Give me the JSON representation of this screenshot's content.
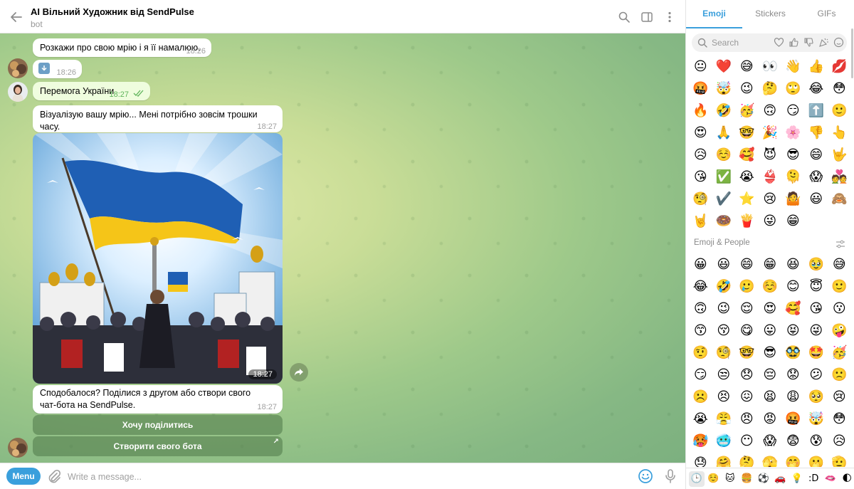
{
  "header": {
    "title": "AI Вільний Художник від SendPulse",
    "subtitle": "bot"
  },
  "messages": [
    {
      "text": "Розкажи про свою мрію і я її намалюю.",
      "time": "18:26"
    },
    {
      "text": "",
      "time": "18:26",
      "icon": "download-icon"
    },
    {
      "text": "Перемога України",
      "time": "18:27",
      "outgoing": true
    },
    {
      "text": "Візуалізую вашу мрію... Мені потрібно зовсім трошки часу.",
      "time": "18:27"
    },
    {
      "text": "",
      "time": "18:27",
      "photo": true
    },
    {
      "text": "Сподобалося? Поділися з другом або створи свого чат-бота на SendPulse.",
      "time": "18:27"
    }
  ],
  "inline_buttons": [
    {
      "label": "Хочу поділитись"
    },
    {
      "label": "Створити свого бота"
    }
  ],
  "composer": {
    "menu_label": "Menu",
    "placeholder": "Write a message..."
  },
  "panel": {
    "tabs": [
      "Emoji",
      "Stickers",
      "GIFs"
    ],
    "active_tab": "Emoji",
    "search_placeholder": "Search",
    "section_title": "Emoji & People",
    "recent": [
      "😐",
      "❤️",
      "😅",
      "👀",
      "👋",
      "👍",
      "💋",
      "🤬",
      "🤯",
      "😉",
      "🤔",
      "🙄",
      "😂",
      "😳",
      "🔥",
      "🤣",
      "🥳",
      "🙃",
      "😏",
      "⬆️",
      "🙂",
      "😍",
      "🙏",
      "🤓",
      "🎉",
      "🌸",
      "👎",
      "👆",
      "😥",
      "☺️",
      "🥰",
      "😈",
      "😎",
      "😄",
      "🤟",
      "😘",
      "✅",
      "😭",
      "👙",
      "🫠",
      "😱",
      "💑",
      "🧐",
      "✔️",
      "⭐",
      "😢",
      "🤷",
      "😃",
      "🙈",
      "🤘",
      "🍩",
      "🍟",
      "😜",
      "😁"
    ],
    "people": [
      "😀",
      "😃",
      "😄",
      "😁",
      "😆",
      "🥹",
      "😅",
      "😂",
      "🤣",
      "🥲",
      "☺️",
      "😊",
      "😇",
      "🙂",
      "🙃",
      "😉",
      "😌",
      "😍",
      "🥰",
      "😘",
      "😗",
      "😙",
      "😚",
      "😋",
      "😛",
      "😝",
      "😜",
      "🤪",
      "🤨",
      "🧐",
      "🤓",
      "😎",
      "🥸",
      "🤩",
      "🥳",
      "😏",
      "😒",
      "😞",
      "😔",
      "😟",
      "😕",
      "🙁",
      "☹️",
      "😣",
      "😖",
      "😫",
      "😩",
      "🥺",
      "😢",
      "😭",
      "😤",
      "😠",
      "😡",
      "🤬",
      "🤯",
      "😳",
      "🥵",
      "🥶",
      "😶",
      "😱",
      "😨",
      "😰",
      "😥",
      "😓",
      "🤗",
      "🤔",
      "🫣",
      "🤭",
      "🫢",
      "🫡",
      "🤫"
    ],
    "bottom_categories": [
      "🕒",
      "☺️",
      "🐱",
      "🍔",
      "⚽",
      "🚗",
      "💡",
      ":D",
      "🫦",
      "🌓"
    ]
  }
}
